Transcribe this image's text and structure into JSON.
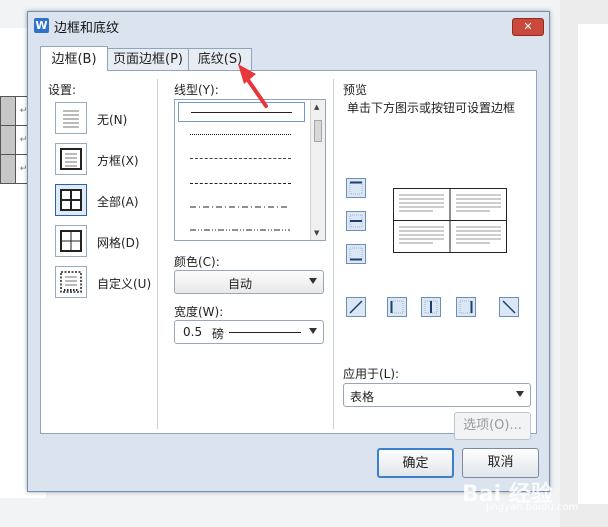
{
  "dialog": {
    "app_icon_letter": "W",
    "title": "边框和底纹",
    "close_glyph": "✕",
    "tabs": [
      {
        "label": "边框(B)",
        "active": true
      },
      {
        "label": "页面边框(P)",
        "active": false
      },
      {
        "label": "底纹(S)",
        "active": false
      }
    ]
  },
  "settings": {
    "label": "设置:",
    "items": [
      {
        "label": "无(N)",
        "icon": "none-border-icon",
        "selected": false
      },
      {
        "label": "方框(X)",
        "icon": "box-border-icon",
        "selected": false
      },
      {
        "label": "全部(A)",
        "icon": "all-borders-icon",
        "selected": true
      },
      {
        "label": "网格(D)",
        "icon": "grid-border-icon",
        "selected": false
      },
      {
        "label": "自定义(U)",
        "icon": "custom-border-icon",
        "selected": false
      }
    ]
  },
  "line": {
    "style_label": "线型(Y):",
    "styles": [
      "solid",
      "dotted",
      "dashed-fine",
      "dashed",
      "dash-dot",
      "dash-dot-dot"
    ],
    "color_label": "颜色(C):",
    "color_value": "自动",
    "width_label": "宽度(W):",
    "width_value": "0.5",
    "width_unit": "磅"
  },
  "preview": {
    "label": "预览",
    "hint": "单击下方图示或按钮可设置边框",
    "apply_label": "应用于(L):",
    "apply_value": "表格",
    "options_button": "选项(O)..."
  },
  "footer": {
    "ok": "确定",
    "cancel": "取消"
  },
  "document": {
    "paragraph_mark": "↵"
  },
  "annotation": {
    "color": "#e8373a"
  },
  "watermark": {
    "text": "Bai 经验",
    "sub": "jingyan.baidu.com"
  }
}
